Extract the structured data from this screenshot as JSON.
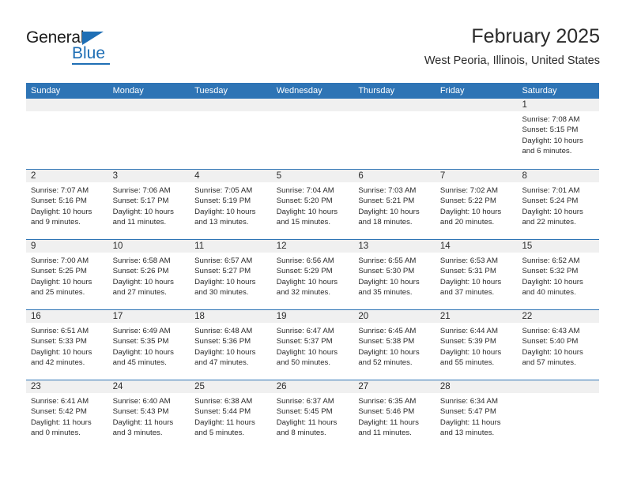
{
  "logo": {
    "word_one": "General",
    "word_two": "Blue",
    "triangle_icon": "blue-triangle-icon"
  },
  "header": {
    "title": "February 2025",
    "subtitle": "West Peoria, Illinois, United States"
  },
  "colors": {
    "header_blue": "#2e74b5",
    "day_band_gray": "#f0f0f0",
    "text_dark": "#2b2b2b",
    "logo_blue": "#1f6fb5"
  },
  "weekdays": [
    "Sunday",
    "Monday",
    "Tuesday",
    "Wednesday",
    "Thursday",
    "Friday",
    "Saturday"
  ],
  "weeks": [
    [
      {
        "day": "",
        "sunrise": "",
        "sunset": "",
        "daylight": ""
      },
      {
        "day": "",
        "sunrise": "",
        "sunset": "",
        "daylight": ""
      },
      {
        "day": "",
        "sunrise": "",
        "sunset": "",
        "daylight": ""
      },
      {
        "day": "",
        "sunrise": "",
        "sunset": "",
        "daylight": ""
      },
      {
        "day": "",
        "sunrise": "",
        "sunset": "",
        "daylight": ""
      },
      {
        "day": "",
        "sunrise": "",
        "sunset": "",
        "daylight": ""
      },
      {
        "day": "1",
        "sunrise": "Sunrise: 7:08 AM",
        "sunset": "Sunset: 5:15 PM",
        "daylight": "Daylight: 10 hours and 6 minutes."
      }
    ],
    [
      {
        "day": "2",
        "sunrise": "Sunrise: 7:07 AM",
        "sunset": "Sunset: 5:16 PM",
        "daylight": "Daylight: 10 hours and 9 minutes."
      },
      {
        "day": "3",
        "sunrise": "Sunrise: 7:06 AM",
        "sunset": "Sunset: 5:17 PM",
        "daylight": "Daylight: 10 hours and 11 minutes."
      },
      {
        "day": "4",
        "sunrise": "Sunrise: 7:05 AM",
        "sunset": "Sunset: 5:19 PM",
        "daylight": "Daylight: 10 hours and 13 minutes."
      },
      {
        "day": "5",
        "sunrise": "Sunrise: 7:04 AM",
        "sunset": "Sunset: 5:20 PM",
        "daylight": "Daylight: 10 hours and 15 minutes."
      },
      {
        "day": "6",
        "sunrise": "Sunrise: 7:03 AM",
        "sunset": "Sunset: 5:21 PM",
        "daylight": "Daylight: 10 hours and 18 minutes."
      },
      {
        "day": "7",
        "sunrise": "Sunrise: 7:02 AM",
        "sunset": "Sunset: 5:22 PM",
        "daylight": "Daylight: 10 hours and 20 minutes."
      },
      {
        "day": "8",
        "sunrise": "Sunrise: 7:01 AM",
        "sunset": "Sunset: 5:24 PM",
        "daylight": "Daylight: 10 hours and 22 minutes."
      }
    ],
    [
      {
        "day": "9",
        "sunrise": "Sunrise: 7:00 AM",
        "sunset": "Sunset: 5:25 PM",
        "daylight": "Daylight: 10 hours and 25 minutes."
      },
      {
        "day": "10",
        "sunrise": "Sunrise: 6:58 AM",
        "sunset": "Sunset: 5:26 PM",
        "daylight": "Daylight: 10 hours and 27 minutes."
      },
      {
        "day": "11",
        "sunrise": "Sunrise: 6:57 AM",
        "sunset": "Sunset: 5:27 PM",
        "daylight": "Daylight: 10 hours and 30 minutes."
      },
      {
        "day": "12",
        "sunrise": "Sunrise: 6:56 AM",
        "sunset": "Sunset: 5:29 PM",
        "daylight": "Daylight: 10 hours and 32 minutes."
      },
      {
        "day": "13",
        "sunrise": "Sunrise: 6:55 AM",
        "sunset": "Sunset: 5:30 PM",
        "daylight": "Daylight: 10 hours and 35 minutes."
      },
      {
        "day": "14",
        "sunrise": "Sunrise: 6:53 AM",
        "sunset": "Sunset: 5:31 PM",
        "daylight": "Daylight: 10 hours and 37 minutes."
      },
      {
        "day": "15",
        "sunrise": "Sunrise: 6:52 AM",
        "sunset": "Sunset: 5:32 PM",
        "daylight": "Daylight: 10 hours and 40 minutes."
      }
    ],
    [
      {
        "day": "16",
        "sunrise": "Sunrise: 6:51 AM",
        "sunset": "Sunset: 5:33 PM",
        "daylight": "Daylight: 10 hours and 42 minutes."
      },
      {
        "day": "17",
        "sunrise": "Sunrise: 6:49 AM",
        "sunset": "Sunset: 5:35 PM",
        "daylight": "Daylight: 10 hours and 45 minutes."
      },
      {
        "day": "18",
        "sunrise": "Sunrise: 6:48 AM",
        "sunset": "Sunset: 5:36 PM",
        "daylight": "Daylight: 10 hours and 47 minutes."
      },
      {
        "day": "19",
        "sunrise": "Sunrise: 6:47 AM",
        "sunset": "Sunset: 5:37 PM",
        "daylight": "Daylight: 10 hours and 50 minutes."
      },
      {
        "day": "20",
        "sunrise": "Sunrise: 6:45 AM",
        "sunset": "Sunset: 5:38 PM",
        "daylight": "Daylight: 10 hours and 52 minutes."
      },
      {
        "day": "21",
        "sunrise": "Sunrise: 6:44 AM",
        "sunset": "Sunset: 5:39 PM",
        "daylight": "Daylight: 10 hours and 55 minutes."
      },
      {
        "day": "22",
        "sunrise": "Sunrise: 6:43 AM",
        "sunset": "Sunset: 5:40 PM",
        "daylight": "Daylight: 10 hours and 57 minutes."
      }
    ],
    [
      {
        "day": "23",
        "sunrise": "Sunrise: 6:41 AM",
        "sunset": "Sunset: 5:42 PM",
        "daylight": "Daylight: 11 hours and 0 minutes."
      },
      {
        "day": "24",
        "sunrise": "Sunrise: 6:40 AM",
        "sunset": "Sunset: 5:43 PM",
        "daylight": "Daylight: 11 hours and 3 minutes."
      },
      {
        "day": "25",
        "sunrise": "Sunrise: 6:38 AM",
        "sunset": "Sunset: 5:44 PM",
        "daylight": "Daylight: 11 hours and 5 minutes."
      },
      {
        "day": "26",
        "sunrise": "Sunrise: 6:37 AM",
        "sunset": "Sunset: 5:45 PM",
        "daylight": "Daylight: 11 hours and 8 minutes."
      },
      {
        "day": "27",
        "sunrise": "Sunrise: 6:35 AM",
        "sunset": "Sunset: 5:46 PM",
        "daylight": "Daylight: 11 hours and 11 minutes."
      },
      {
        "day": "28",
        "sunrise": "Sunrise: 6:34 AM",
        "sunset": "Sunset: 5:47 PM",
        "daylight": "Daylight: 11 hours and 13 minutes."
      },
      {
        "day": "",
        "sunrise": "",
        "sunset": "",
        "daylight": ""
      }
    ]
  ]
}
